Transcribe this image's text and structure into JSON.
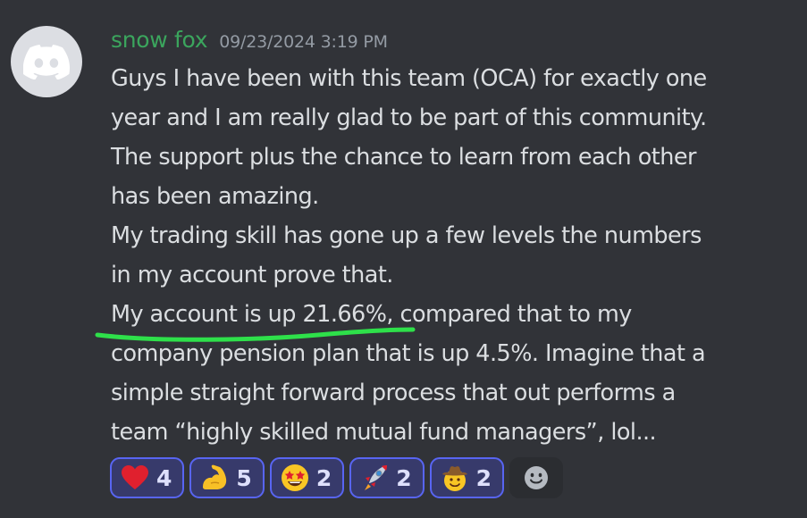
{
  "message": {
    "author": "snow fox",
    "timestamp": "09/23/2024 3:19 PM",
    "lines": [
      "Guys I have been with this team (OCA) for exactly one",
      "year and I am really glad to be part of this community.",
      "The support plus the chance to learn from each other",
      "has been amazing.",
      "My trading skill has gone up a few levels the numbers",
      "in my account prove that.",
      "compared that to my",
      "company pension plan that is up 4.5%. Imagine that a",
      "simple straight forward process that out performs a",
      "team  “highly skilled mutual fund managers”, lol..."
    ],
    "highlighted_text": "My account is up 21.66%,"
  },
  "reactions": [
    {
      "icon": "red-heart-icon",
      "count": "4"
    },
    {
      "icon": "flexed-biceps-icon",
      "count": "5"
    },
    {
      "icon": "star-struck-icon",
      "count": "2"
    },
    {
      "icon": "rocket-icon",
      "count": "2"
    },
    {
      "icon": "cowboy-face-icon",
      "count": "2"
    }
  ],
  "add_reaction_icon": "add-reaction-smiley-icon",
  "colors": {
    "background": "#313338",
    "username": "#3ba55d",
    "timestamp": "#949ba4",
    "text": "#dbdee1",
    "reaction_border": "#5865f2",
    "reaction_bg": "#373a6b",
    "highlight_underline": "#2ee04a"
  }
}
